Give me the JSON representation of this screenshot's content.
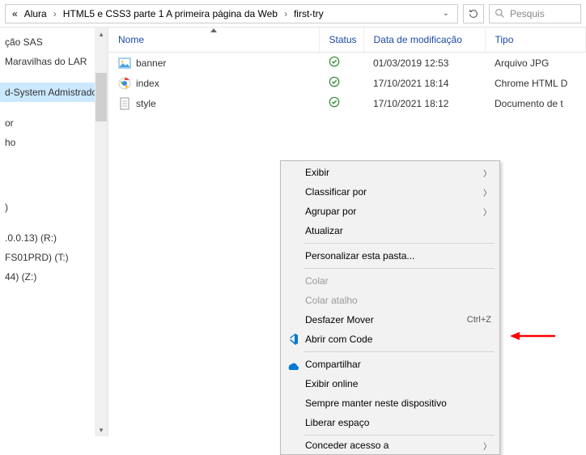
{
  "breadcrumb": {
    "prefix": "«",
    "segments": [
      "Alura",
      "HTML5 e CSS3 parte 1 A primeira página da Web",
      "first-try"
    ]
  },
  "search": {
    "placeholder": "Pesquis"
  },
  "columns": {
    "name": "Nome",
    "status": "Status",
    "modified": "Data de modificação",
    "type": "Tipo"
  },
  "files": [
    {
      "icon": "image",
      "name": "banner",
      "date": "01/03/2019 12:53",
      "type": "Arquivo JPG"
    },
    {
      "icon": "chrome",
      "name": "index",
      "date": "17/10/2021 18:14",
      "type": "Chrome HTML D"
    },
    {
      "icon": "doc",
      "name": "style",
      "date": "17/10/2021 18:12",
      "type": "Documento de t"
    }
  ],
  "sidebar": {
    "items": [
      "ção SAS",
      "Maravilhas do LAR",
      "",
      "d-System Admistrador",
      "",
      "or",
      "ho",
      "",
      "",
      "",
      "",
      ")",
      "",
      ".0.0.13) (R:)",
      "FS01PRD) (T:)",
      "44) (Z:)"
    ],
    "selected_index": 3
  },
  "context_menu": {
    "items": [
      {
        "label": "Exibir",
        "submenu": true
      },
      {
        "label": "Classificar por",
        "submenu": true
      },
      {
        "label": "Agrupar por",
        "submenu": true
      },
      {
        "label": "Atualizar"
      },
      {
        "sep": true
      },
      {
        "label": "Personalizar esta pasta..."
      },
      {
        "sep": true
      },
      {
        "label": "Colar",
        "disabled": true
      },
      {
        "label": "Colar atalho",
        "disabled": true
      },
      {
        "label": "Desfazer Mover",
        "shortcut": "Ctrl+Z"
      },
      {
        "label": "Abrir com Code",
        "icon": "vscode"
      },
      {
        "sep": true
      },
      {
        "label": "Compartilhar",
        "icon": "onedrive"
      },
      {
        "label": "Exibir online"
      },
      {
        "label": "Sempre manter neste dispositivo"
      },
      {
        "label": "Liberar espaço"
      },
      {
        "sep": true
      },
      {
        "label": "Conceder acesso a",
        "submenu": true,
        "truncated": true
      }
    ]
  }
}
